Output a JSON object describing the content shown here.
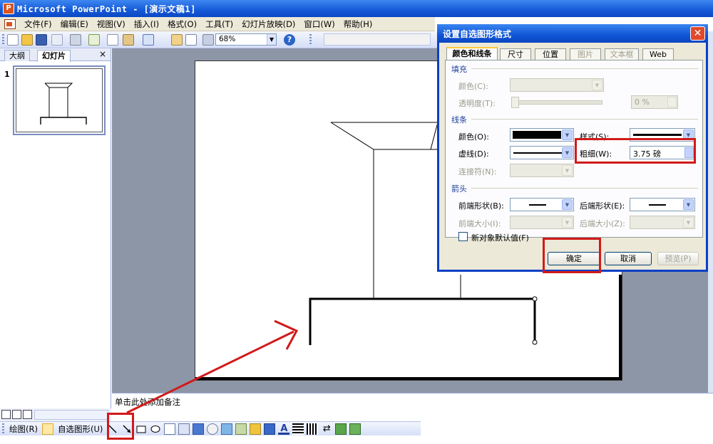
{
  "window": {
    "title": "Microsoft PowerPoint - [演示文稿1]",
    "app_icon_letter": "P"
  },
  "menubar": {
    "items": [
      "文件(F)",
      "编辑(E)",
      "视图(V)",
      "插入(I)",
      "格式(O)",
      "工具(T)",
      "幻灯片放映(D)",
      "窗口(W)",
      "帮助(H)"
    ]
  },
  "toolbar": {
    "zoom": "68%",
    "help_glyph": "?"
  },
  "left_panel": {
    "tabs": [
      "大纲",
      "幻灯片"
    ],
    "active_tab": "幻灯片",
    "close_glyph": "×",
    "slide_number": "1"
  },
  "notes": {
    "placeholder": "单击此处添加备注"
  },
  "drawing_toolbar": {
    "draw_label": "绘图(R)",
    "autoshape_label": "自选图形(U)"
  },
  "dialog": {
    "title": "设置自选图形格式",
    "close_glyph": "✕",
    "tabs": [
      {
        "label": "颜色和线条",
        "active": true,
        "enabled": true
      },
      {
        "label": "尺寸",
        "active": false,
        "enabled": true
      },
      {
        "label": "位置",
        "active": false,
        "enabled": true
      },
      {
        "label": "图片",
        "active": false,
        "enabled": false
      },
      {
        "label": "文本框",
        "active": false,
        "enabled": false
      },
      {
        "label": "Web",
        "active": false,
        "enabled": true
      }
    ],
    "fill": {
      "section": "填充",
      "color_label": "颜色(C):",
      "transparency_label": "透明度(T):",
      "transparency_value": "0 %"
    },
    "line": {
      "section": "线条",
      "color_label": "颜色(O):",
      "color_value": "#000000",
      "style_label": "样式(S):",
      "dash_label": "虚线(D):",
      "weight_label": "粗细(W):",
      "weight_value": "3.75 磅",
      "connector_label": "连接符(N):"
    },
    "arrows": {
      "section": "箭头",
      "begin_style_label": "前端形状(B):",
      "end_style_label": "后端形状(E):",
      "begin_size_label": "前端大小(I):",
      "end_size_label": "后端大小(Z):"
    },
    "default_checkbox_label": "新对象默认值(F)",
    "buttons": {
      "ok": "确定",
      "cancel": "取消",
      "preview": "预览(P)"
    }
  },
  "colors": {
    "titlebar": "#1559d8",
    "highlight_red": "#d11a1a",
    "workspace": "#8d96a7"
  }
}
